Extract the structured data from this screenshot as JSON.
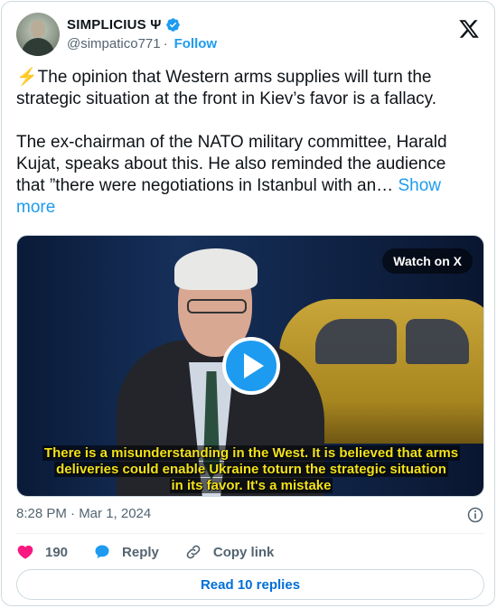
{
  "author": {
    "display_name": "SIMPLICIUS Ψ",
    "handle": "@simpatico771",
    "follow_label": "Follow"
  },
  "tweet": {
    "text": "⚡The opinion that Western arms supplies will turn the strategic situation at the front in Kiev’s favor is a fallacy.\n\nThe ex-chairman of the NATO military committee, Harald Kujat, speaks about this. He also reminded the audience that ”there were negotiations in Istanbul with an… ",
    "show_more_label": "Show more"
  },
  "media": {
    "watch_label": "Watch on X",
    "subtitle_line1": "There is a misunderstanding in the West. It is believed that arms",
    "subtitle_line2": "deliveries could enable Ukraine toturn the strategic situation",
    "subtitle_line3": "in its favor. It's a mistake"
  },
  "meta": {
    "timestamp": "8:28 PM · Mar 1, 2024"
  },
  "actions": {
    "like_count": "190",
    "reply_label": "Reply",
    "copy_link_label": "Copy link"
  },
  "read_replies_label": "Read 10 replies",
  "colors": {
    "accent": "#1d9bf0",
    "like": "#f91880",
    "muted": "#536471",
    "subtitle": "#f2e21a"
  },
  "icons": [
    "verified-badge-icon",
    "x-logo-icon",
    "play-icon",
    "info-icon",
    "heart-icon",
    "reply-icon",
    "link-icon"
  ]
}
